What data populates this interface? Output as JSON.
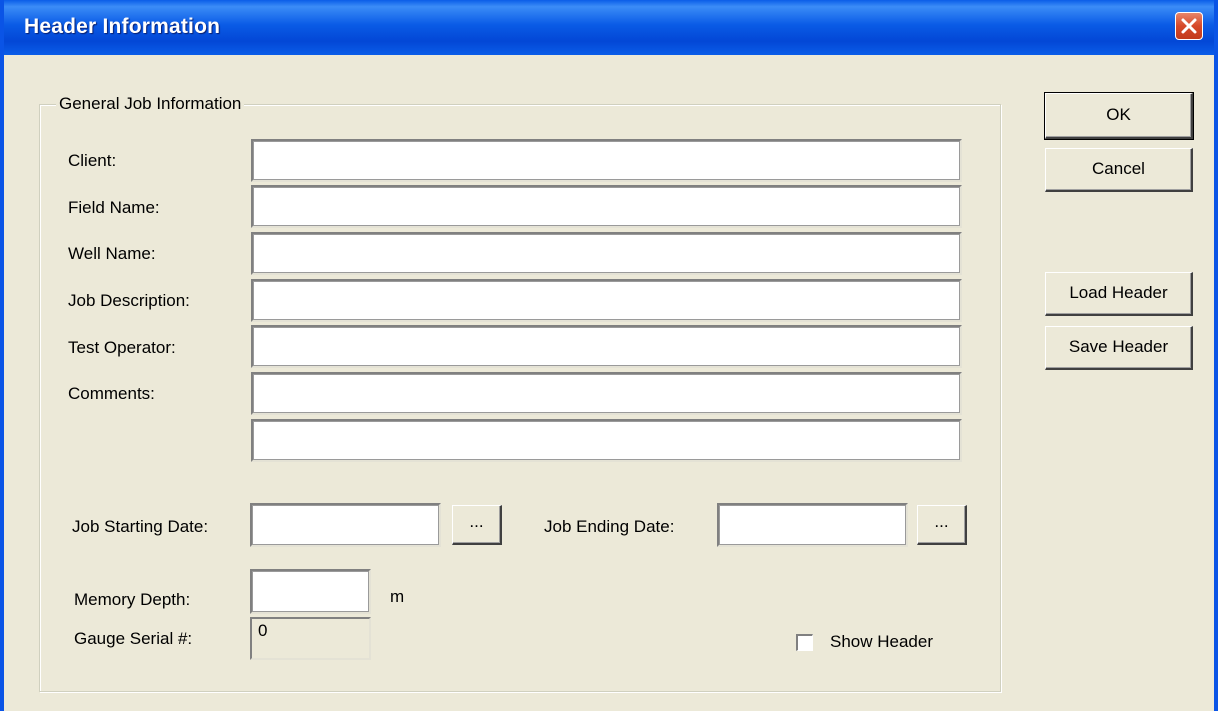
{
  "window": {
    "title": "Header Information"
  },
  "group": {
    "legend": "General Job Information"
  },
  "labels": {
    "client": "Client:",
    "field_name": "Field Name:",
    "well_name": "Well Name:",
    "job_description": "Job Description:",
    "test_operator": "Test Operator:",
    "comments": "Comments:",
    "job_starting_date": "Job Starting Date:",
    "job_ending_date": "Job Ending Date:",
    "memory_depth": "Memory Depth:",
    "memory_depth_unit": "m",
    "gauge_serial": "Gauge Serial #:"
  },
  "values": {
    "client": "",
    "field_name": "",
    "well_name": "",
    "job_description": "",
    "test_operator": "",
    "comments_line1": "",
    "comments_line2": "",
    "job_starting_date": "",
    "job_ending_date": "",
    "memory_depth": "",
    "gauge_serial": "0"
  },
  "buttons": {
    "ok": "OK",
    "cancel": "Cancel",
    "load_header": "Load Header",
    "save_header": "Save Header",
    "start_date_picker": "...",
    "end_date_picker": "..."
  },
  "checkbox": {
    "show_header_label": "Show Header",
    "show_header_checked": false
  },
  "colors": {
    "title_bar": "#0a5be6",
    "dialog_bg": "#ece9d8",
    "close_button": "#d6492a"
  },
  "icons": {
    "close": "close-x-icon"
  }
}
